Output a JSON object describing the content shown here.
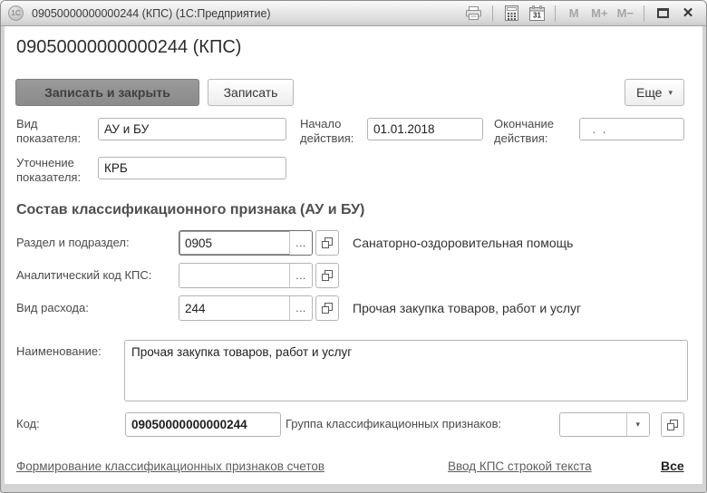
{
  "window": {
    "logo": "1С",
    "title": "09050000000000244 (КПС)  (1С:Предприятие)",
    "memory": [
      "M",
      "M+",
      "M−"
    ]
  },
  "icons": {
    "ellipsis": "...",
    "dropdown": "▾",
    "close": "✕",
    "calendar_day": "31"
  },
  "header": {
    "title": "09050000000000244 (КПС)"
  },
  "toolbar": {
    "save_close": "Записать и закрыть",
    "save": "Записать",
    "more": "Еще"
  },
  "form": {
    "vid": {
      "label": "Вид показателя:",
      "value": "АУ и БУ"
    },
    "start": {
      "label": "Начало действия:",
      "value": "01.01.2018"
    },
    "end": {
      "label": "Окончание действия:",
      "value": "  .  .    "
    },
    "utochnenie": {
      "label": "Уточнение показателя:",
      "value": "КРБ"
    },
    "section_title": "Состав классификационного признака (АУ и БУ)",
    "razdel": {
      "label": "Раздел и подраздел:",
      "value": "0905",
      "desc": "Санаторно-оздоровительная помощь"
    },
    "analytic": {
      "label": "Аналитический код КПС:",
      "value": "",
      "desc": ""
    },
    "rashod": {
      "label": "Вид расхода:",
      "value": "244",
      "desc": "Прочая закупка товаров, работ и услуг"
    },
    "name": {
      "label": "Наименование:",
      "value": "Прочая закупка товаров, работ и услуг"
    },
    "code": {
      "label": "Код:",
      "value": "09050000000000244"
    },
    "group": {
      "label": "Группа классификационных признаков:",
      "value": ""
    }
  },
  "links": {
    "form_signs": "Формирование классификационных признаков счетов",
    "input_text": "Ввод КПС строкой текста",
    "all": "Все"
  }
}
